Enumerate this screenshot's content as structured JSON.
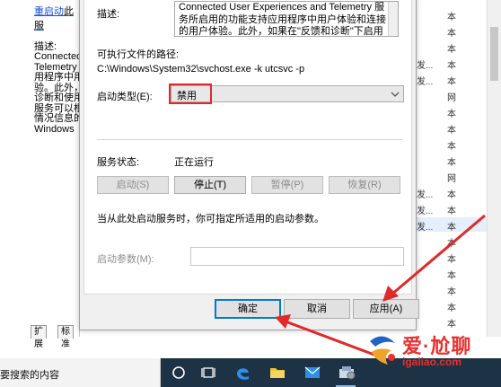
{
  "background": {
    "left_panel": {
      "restart_link": "重启动",
      "restart_rest": "此服",
      "desc_label": "描述:",
      "desc_lines": [
        "Connected",
        "Telemetry",
        "用程序中用",
        "验。此外，",
        "诊断和使用",
        "服务可以根",
        "情况信息的",
        "Windows"
      ]
    },
    "tabs": [
      "扩展",
      "标准"
    ],
    "right_rows": [
      {
        "c1": "",
        "c2": "本"
      },
      {
        "c1": "",
        "c2": "本"
      },
      {
        "c1": "",
        "c2": "本"
      },
      {
        "c1": "发...",
        "c2": "本"
      },
      {
        "c1": "发...",
        "c2": "本"
      },
      {
        "c1": "",
        "c2": "网"
      },
      {
        "c1": "",
        "c2": "本"
      },
      {
        "c1": "",
        "c2": "本"
      },
      {
        "c1": "",
        "c2": "本"
      },
      {
        "c1": "",
        "c2": "本"
      },
      {
        "c1": "",
        "c2": "网"
      },
      {
        "c1": "发...",
        "c2": "本"
      },
      {
        "c1": "发...",
        "c2": "本"
      },
      {
        "c1": "发...",
        "c2": "本"
      },
      {
        "c1": "",
        "c2": "本"
      },
      {
        "c1": "",
        "c2": "本"
      },
      {
        "c1": "",
        "c2": "本"
      },
      {
        "c1": "",
        "c2": "本"
      },
      {
        "c1": "",
        "c2": "本"
      },
      {
        "c1": "",
        "c2": "本"
      },
      {
        "c1": "",
        "c2": "本"
      }
    ]
  },
  "dialog": {
    "description_label": "描述:",
    "description_text": "Connected User Experiences and Telemetry 服务所启用的功能支持应用程序中用户体验和连接的用户体验。此外，如果在\"反馈和诊断\"下启用诊断和使用情况",
    "exe_path_label": "可执行文件的路径:",
    "exe_path": "C:\\Windows\\System32\\svchost.exe -k utcsvc -p",
    "startup_type_label": "启动类型(E):",
    "startup_type_value": "禁用",
    "service_status_label": "服务状态:",
    "service_status_value": "正在运行",
    "buttons": {
      "start": "启动(S)",
      "stop": "停止(T)",
      "pause": "暂停(P)",
      "resume": "恢复(R)"
    },
    "hint_text": "当从此处启动服务时，你可指定所适用的启动参数。",
    "params_label": "启动参数(M):",
    "params_value": "",
    "ok": "确定",
    "cancel": "取消",
    "apply": "应用(A)"
  },
  "taskbar": {
    "search_text": "要搜索的内容"
  },
  "watermark": {
    "title": "爱·尬聊",
    "domain": "igaliao.com"
  },
  "colors": {
    "highlight_red": "#e0292b",
    "taskbar": "#1e3246",
    "link_blue": "#1a4fd6",
    "watermark_red": "#e8302e"
  }
}
